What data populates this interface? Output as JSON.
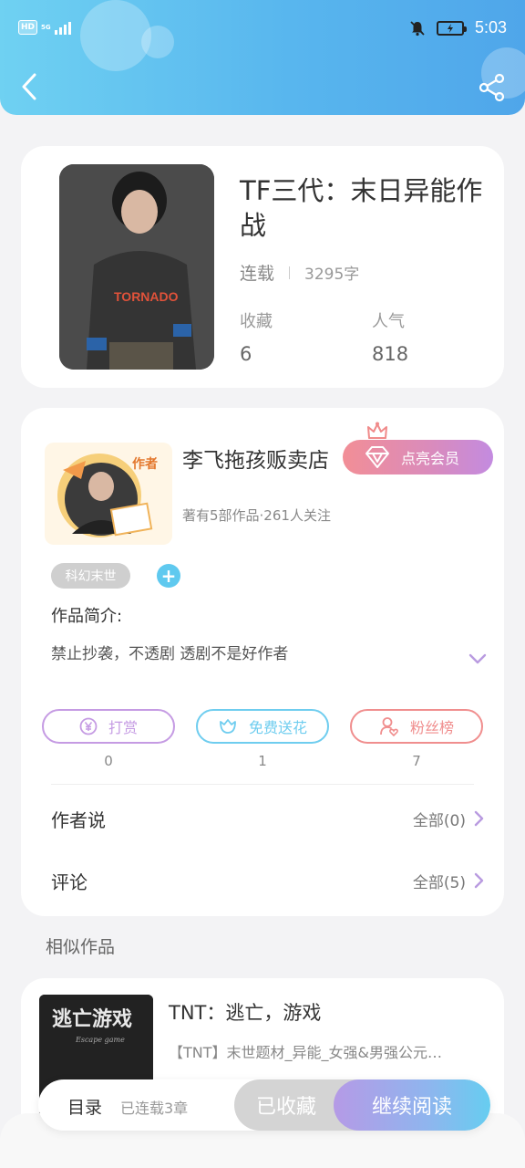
{
  "status_bar": {
    "hd": "HD",
    "network": "5G",
    "time": "5:03"
  },
  "book": {
    "title": "TF三代：末日异能作战",
    "status": "连载",
    "word_count": "3295字",
    "favorites_label": "收藏",
    "favorites_value": "6",
    "popularity_label": "人气",
    "popularity_value": "818"
  },
  "author": {
    "name": "李飞拖孩贩卖店",
    "meta": "著有5部作品·261人关注",
    "vip_button": "点亮会员",
    "avatar_badge": "作者",
    "genre_tag": "科幻末世",
    "intro_label": "作品简介:",
    "intro_text": "禁止抄袭，不透剧 透剧不是好作者"
  },
  "actions": [
    {
      "label": "打赏",
      "count": "0",
      "color": "#c59be3"
    },
    {
      "label": "免费送花",
      "count": "1",
      "color": "#6fcdef"
    },
    {
      "label": "粉丝榜",
      "count": "7",
      "color": "#f08e8e"
    }
  ],
  "rows": {
    "author_says_label": "作者说",
    "author_says_value": "全部(0)",
    "comments_label": "评论",
    "comments_value": "全部(5)"
  },
  "similar": {
    "section_title": "相似作品",
    "title": "TNT：逃亡，游戏",
    "desc": "【TNT】末世题材_异能_女强&男强公元…",
    "cover_text": "逃亡游戏",
    "cover_sub": "Escape game"
  },
  "bottom_bar": {
    "toc": "目录",
    "progress": "已连载3章",
    "favorited": "已收藏",
    "continue": "继续阅读"
  }
}
